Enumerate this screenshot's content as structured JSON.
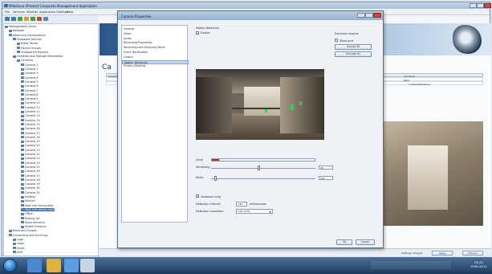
{
  "app": {
    "title": "Milestone XProtect Corporate Management Application",
    "menu": [
      "File",
      "Services",
      "Wizards",
      "Application Settings",
      "Help"
    ]
  },
  "tree": [
    {
      "label": "Management Server",
      "level": 0
    },
    {
      "label": "Network",
      "level": 1
    },
    {
      "label": "Advanced Configuration",
      "level": 1
    },
    {
      "label": "Hardware Devices",
      "level": 2
    },
    {
      "label": "Video Server",
      "level": 3
    },
    {
      "label": "Device Groups",
      "level": 3
    },
    {
      "label": "Unassigned Devices",
      "level": 3
    },
    {
      "label": "Cameras and Storage Information",
      "level": 2
    },
    {
      "label": "Cameras",
      "level": 3
    },
    {
      "label": "Camera 1",
      "level": 4
    },
    {
      "label": "Camera 2",
      "level": 4
    },
    {
      "label": "Camera 3",
      "level": 4
    },
    {
      "label": "Camera 4",
      "level": 4
    },
    {
      "label": "Camera 5",
      "level": 4
    },
    {
      "label": "Camera 6",
      "level": 4
    },
    {
      "label": "Camera 7",
      "level": 4
    },
    {
      "label": "Camera 8",
      "level": 4
    },
    {
      "label": "Camera 9",
      "level": 4
    },
    {
      "label": "Camera 10",
      "level": 4
    },
    {
      "label": "Camera 11",
      "level": 4
    },
    {
      "label": "Camera 12",
      "level": 4
    },
    {
      "label": "Camera 13",
      "level": 4
    },
    {
      "label": "Camera 14",
      "level": 4
    },
    {
      "label": "Camera 15",
      "level": 4
    },
    {
      "label": "Camera 16",
      "level": 4
    },
    {
      "label": "Camera 17",
      "level": 4
    },
    {
      "label": "Camera 18",
      "level": 4
    },
    {
      "label": "Camera 19",
      "level": 4
    },
    {
      "label": "Camera 20",
      "level": 4
    },
    {
      "label": "Camera 21",
      "level": 4
    },
    {
      "label": "Camera 22",
      "level": 4
    },
    {
      "label": "Camera 23",
      "level": 4
    },
    {
      "label": "Camera 24",
      "level": 4
    },
    {
      "label": "Camera 25",
      "level": 4
    },
    {
      "label": "Camera 26",
      "level": 4
    },
    {
      "label": "Camera 27",
      "level": 4
    },
    {
      "label": "Camera 28",
      "level": 4
    },
    {
      "label": "Camera 29",
      "level": 4
    },
    {
      "label": "Camera 30",
      "level": 4
    },
    {
      "label": "Camera 31",
      "level": 4
    },
    {
      "label": "Hallway",
      "level": 4
    },
    {
      "label": "Kitchen",
      "level": 4
    },
    {
      "label": "Main hall facing east",
      "level": 4
    },
    {
      "label": "Main hall facing north",
      "level": 4,
      "selected": true
    },
    {
      "label": "Office",
      "level": 4
    },
    {
      "label": "Parking lot",
      "level": 4
    },
    {
      "label": "Store entrance",
      "level": 4
    },
    {
      "label": "Street entrance",
      "level": 4
    },
    {
      "label": "Rules and Output",
      "level": 1
    },
    {
      "label": "Scheduling and Archiving",
      "level": 1
    },
    {
      "label": "Logs",
      "level": 2
    },
    {
      "label": "Login",
      "level": 2
    },
    {
      "label": "Email",
      "level": 2
    },
    {
      "label": "SMS",
      "level": 2
    }
  ],
  "background": {
    "heading": "Ca",
    "grid_headers": [
      "Camera",
      "",
      "",
      "Archiving",
      ""
    ],
    "grid_row": [
      "",
      "Path",
      "C:\\MediaDatabase"
    ],
    "status_label": "Settings changed",
    "apply_label": "Apply",
    "discard_label": "Discard"
  },
  "dialog": {
    "title": "Camera Properties",
    "nav": [
      "General",
      "Video",
      "Audio",
      "Recording Properties",
      "Recording and Archiving Paths",
      "Event Notification",
      "Output",
      "Motion Detection",
      "Privacy Masking"
    ],
    "nav_selected": 7,
    "motion_title": "Motion Detection",
    "enable_label": "Enable",
    "enable_checked": true,
    "exclude_title": "Exclusion regions",
    "show_grid_label": "Show grid",
    "include_all_label": "Include All",
    "exclude_all_label": "Exclude All",
    "level_label": "Level",
    "level_fraction": 0.07,
    "sensitivity_label": "Sensitivity",
    "sensitivity_value": "46",
    "sensitivity_fraction": 0.46,
    "noise_label": "Noise",
    "noise_value": "500",
    "noise_fraction": 0.04,
    "hardware_label": "Hardware plug",
    "hardware_checked": true,
    "interval_label": "Detection interval",
    "interval_value": "240",
    "interval_unit": "milliseconds",
    "resolution_label": "Detection resolution",
    "resolution_value": "Fast (8*8)",
    "ok_label": "OK",
    "cancel_label": "Cancel"
  },
  "taskbar": {
    "time": "09:15",
    "date": "2009-04-21"
  },
  "colors": {
    "accent": "#3a6fb3",
    "level": "#e0201a",
    "motion": "#31d24a"
  }
}
